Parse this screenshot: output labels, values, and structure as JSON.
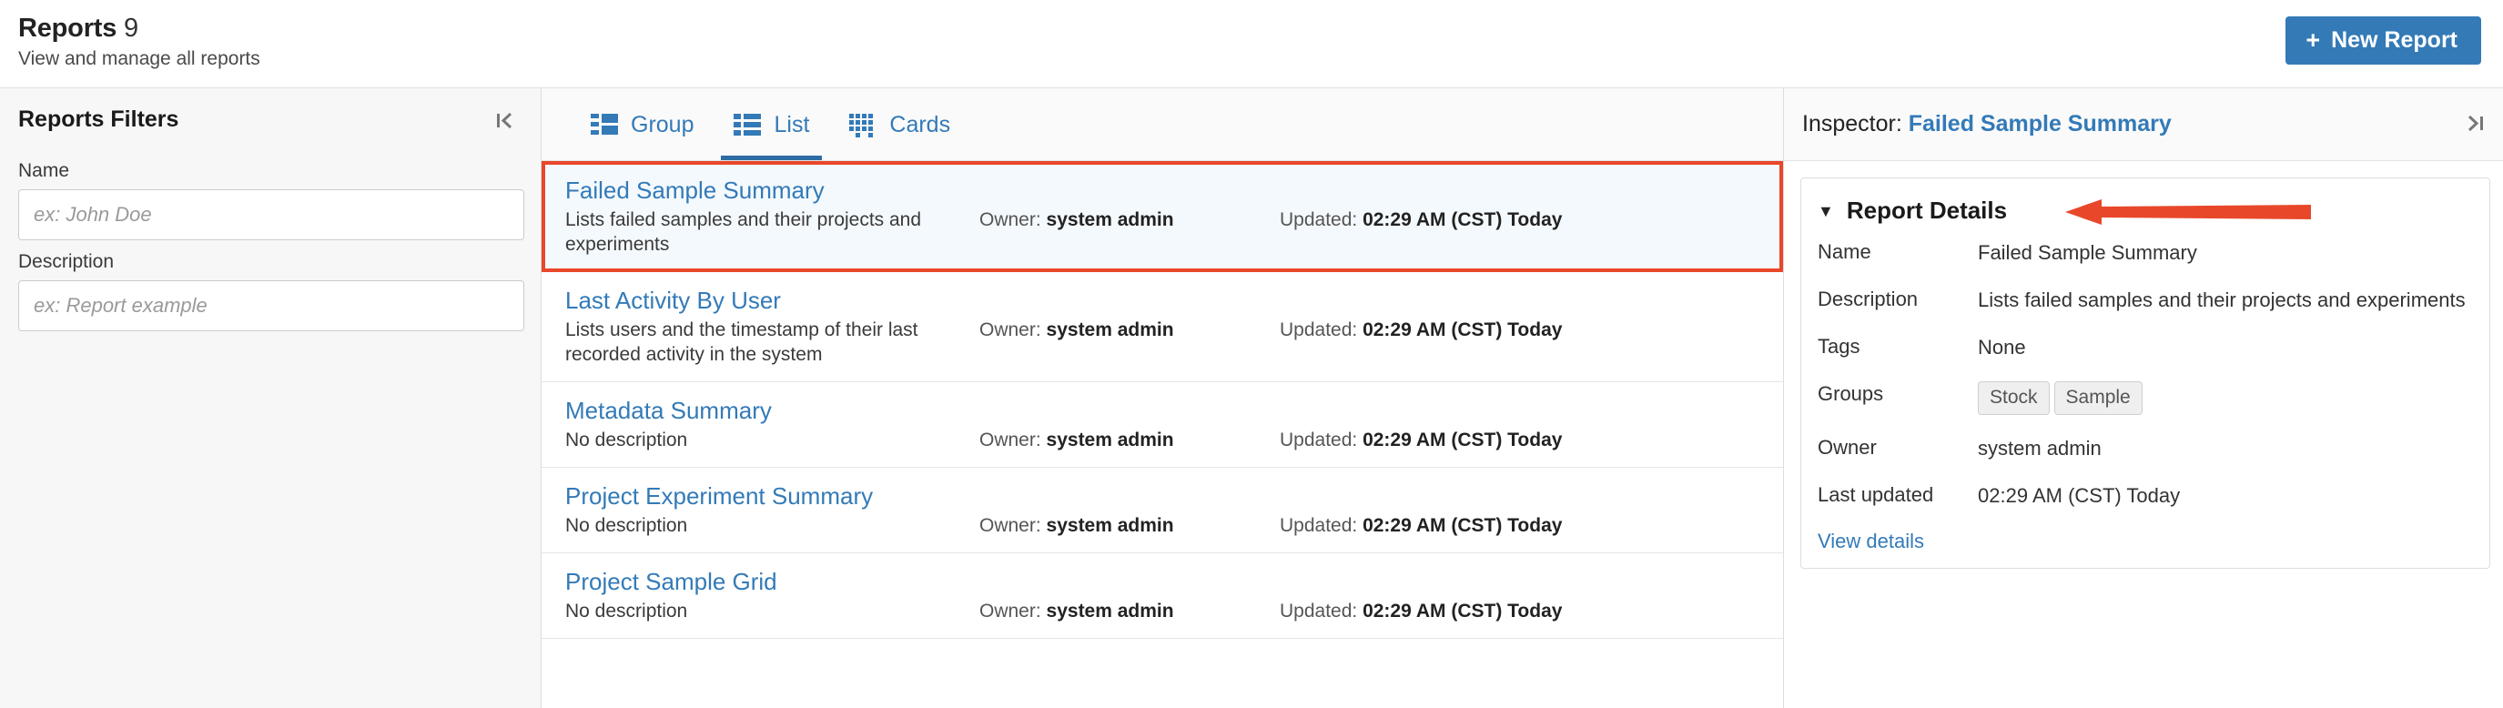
{
  "header": {
    "title": "Reports",
    "count": "9",
    "subtitle": "View and manage all reports",
    "new_report_label": "New Report",
    "plus_icon": "+",
    "accent_color": "#337ab7"
  },
  "filters": {
    "title": "Reports Filters",
    "collapse_icon": "|‹",
    "name_label": "Name",
    "name_value": "",
    "name_placeholder": "ex: John Doe",
    "description_label": "Description",
    "description_value": "",
    "description_placeholder": "ex: Report example"
  },
  "tabs": [
    {
      "label": "Group",
      "icon": "group-view-icon",
      "active": false
    },
    {
      "label": "List",
      "icon": "list-view-icon",
      "active": true
    },
    {
      "label": "Cards",
      "icon": "cards-view-icon",
      "active": true
    }
  ],
  "list": {
    "owner_prefix": "Owner:",
    "updated_prefix": "Updated:",
    "selection_highlight_color": "#e8472a",
    "rows": [
      {
        "name": "Failed Sample Summary",
        "description": "Lists failed samples and their projects and experiments",
        "owner": "system admin",
        "updated": "02:29 AM (CST) Today",
        "selected": true
      },
      {
        "name": "Last Activity By User",
        "description": "Lists users and the timestamp of their last recorded activity in the system",
        "owner": "system admin",
        "updated": "02:29 AM (CST) Today",
        "selected": false
      },
      {
        "name": "Metadata Summary",
        "description": "No description",
        "owner": "system admin",
        "updated": "02:29 AM (CST) Today",
        "selected": false
      },
      {
        "name": "Project Experiment Summary",
        "description": "No description",
        "owner": "system admin",
        "updated": "02:29 AM (CST) Today",
        "selected": false
      },
      {
        "name": "Project Sample Grid",
        "description": "No description",
        "owner": "system admin",
        "updated": "02:29 AM (CST) Today",
        "selected": false
      }
    ]
  },
  "inspector": {
    "prefix": "Inspector:",
    "subject": "Failed Sample Summary",
    "collapse_icon": "›|",
    "panel_title": "Report Details",
    "caret": "▼",
    "fields": [
      {
        "label": "Name",
        "value": "Failed Sample Summary"
      },
      {
        "label": "Description",
        "value": "Lists failed samples and their projects and experiments"
      },
      {
        "label": "Tags",
        "value": "None"
      }
    ],
    "groups_label": "Groups",
    "groups": [
      "Stock",
      "Sample"
    ],
    "owner_label": "Owner",
    "owner_value": "system admin",
    "last_updated_label": "Last updated",
    "last_updated_value": "02:29 AM (CST) Today",
    "view_details_label": "View details",
    "annotation_arrow_color": "#e8472a"
  }
}
